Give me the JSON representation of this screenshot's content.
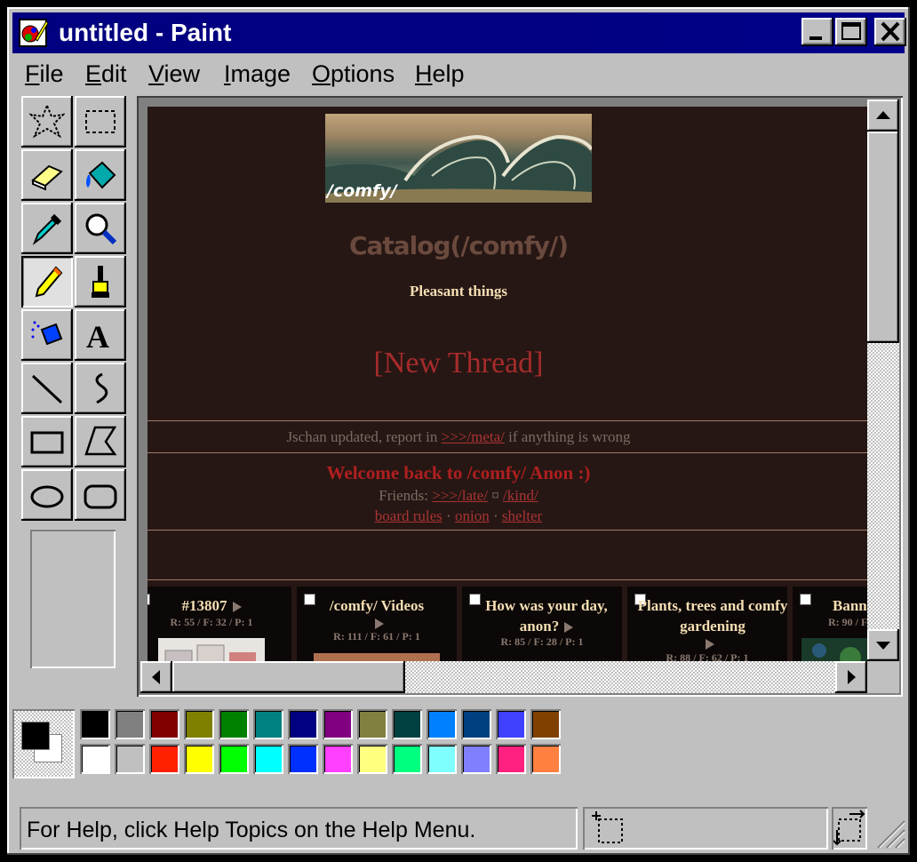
{
  "window": {
    "title": "untitled - Paint",
    "icon": "paint-icon"
  },
  "menu": [
    {
      "label": "File",
      "accel": "F",
      "rest": "ile"
    },
    {
      "label": "Edit",
      "accel": "E",
      "rest": "dit"
    },
    {
      "label": "View",
      "accel": "V",
      "rest": "iew"
    },
    {
      "label": "Image",
      "accel": "I",
      "rest": "mage"
    },
    {
      "label": "Options",
      "accel": "O",
      "rest": "ptions"
    },
    {
      "label": "Help",
      "accel": "H",
      "rest": "elp"
    }
  ],
  "tools": [
    "free-form-select-icon",
    "select-icon",
    "eraser-icon",
    "fill-icon",
    "pick-color-icon",
    "magnifier-icon",
    "pencil-icon",
    "brush-icon",
    "airbrush-icon",
    "text-icon",
    "line-icon",
    "curve-icon",
    "rectangle-icon",
    "polygon-icon",
    "ellipse-icon",
    "rounded-rectangle-icon"
  ],
  "selected_tool": "pencil-icon",
  "page": {
    "banner_text": "/comfy/",
    "catalog_title": "Catalog(/comfy/)",
    "subtitle": "Pleasant things",
    "new_thread": "[New Thread]",
    "notice_pre": "Jschan updated, report in ",
    "notice_link": ">>>/meta/",
    "notice_post": " if anything is wrong",
    "welcome": "Welcome back to /comfy/ Anon :)",
    "friends_label": "Friends: ",
    "friends_link1": ">>>/late/",
    "friends_sep": " ¤ ",
    "friends_link2": "/kind/",
    "rules_link": "board rules",
    "dot1": " · ",
    "onion_link": "onion",
    "dot2": " · ",
    "shelter_link": "shelter",
    "threads": [
      {
        "title": "#13807",
        "stats": "R: 55 / F: 32 / P: 1"
      },
      {
        "title": "/comfy/ Videos",
        "stats": "R: 111 / F: 61 / P: 1"
      },
      {
        "title": "How was your day, anon?",
        "stats": "R: 85 / F: 28 / P: 1"
      },
      {
        "title": "Plants, trees and comfy gardening",
        "stats": "R: 88 / F: 62 / P: 1"
      },
      {
        "title": "Bann",
        "stats": "R: 90 / F"
      }
    ]
  },
  "palette": {
    "foreground": "#000000",
    "background": "#ffffff",
    "row1": [
      "#000000",
      "#808080",
      "#800000",
      "#808000",
      "#008000",
      "#008080",
      "#000080",
      "#800080",
      "#808040",
      "#004040",
      "#0080ff",
      "#004080",
      "#4040ff",
      "#804000"
    ],
    "row2": [
      "#ffffff",
      "#c0c0c0",
      "#ff2000",
      "#ffff00",
      "#00ff00",
      "#00ffff",
      "#0030ff",
      "#ff40ff",
      "#ffff80",
      "#00ff80",
      "#80ffff",
      "#8080ff",
      "#ff2080",
      "#ff8040"
    ]
  },
  "status": {
    "help_text": "For Help, click Help Topics on the Help Menu."
  }
}
